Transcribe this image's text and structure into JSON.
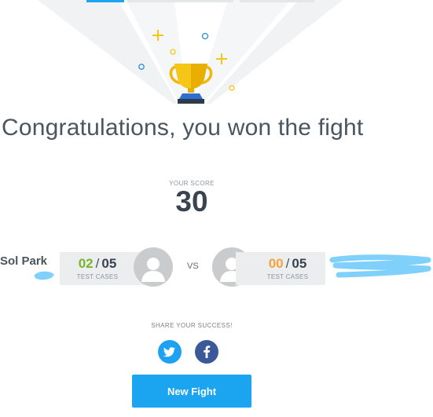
{
  "result": {
    "title": "Congratulations, you won the fight",
    "score_label": "YOUR SCORE",
    "score_value": "30"
  },
  "match": {
    "player": {
      "name": "Sol Park",
      "passed": "02",
      "total": "05",
      "cases_label": "TEST CASES"
    },
    "vs_label": "VS",
    "opponent": {
      "passed": "00",
      "total": "05",
      "cases_label": "TEST CASES"
    },
    "separator": "/"
  },
  "share": {
    "label": "SHARE YOUR SUCCESS!",
    "networks": [
      {
        "icon": "twitter-icon",
        "color": "#1da1f2"
      },
      {
        "icon": "facebook-icon",
        "color": "#3b5998"
      }
    ]
  },
  "actions": {
    "new_fight_label": "New Fight"
  },
  "colors": {
    "accent": "#1ba4ef",
    "passed_green": "#78b52a",
    "passed_orange": "#f5a33a",
    "trophy_gold": "#f5c518",
    "redaction_blue": "#7fd0fb"
  }
}
